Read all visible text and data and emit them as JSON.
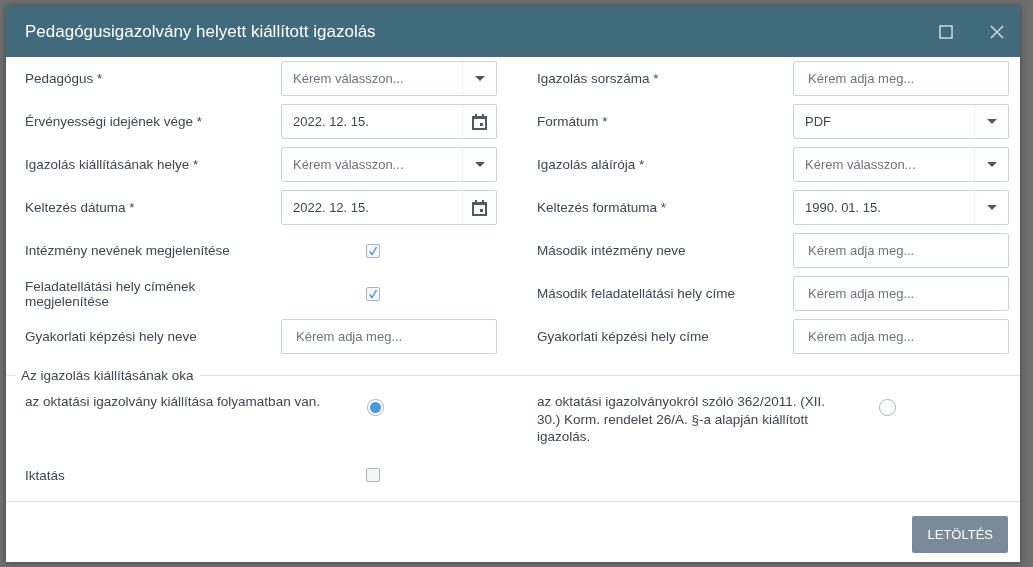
{
  "dialog": {
    "title": "Pedagógusigazolvány helyett kiállított igazolás"
  },
  "rows": [
    {
      "left": {
        "label": "Pedagógus *",
        "kind": "select",
        "placeholder": "Kérem válasszon..."
      },
      "right": {
        "label": "Igazolás sorszáma *",
        "kind": "text",
        "placeholder": "Kérem adja meg..."
      }
    },
    {
      "left": {
        "label": "Érvényességi idejének vége *",
        "kind": "date",
        "value": "2022. 12. 15."
      },
      "right": {
        "label": "Formátum *",
        "kind": "select",
        "value": "PDF"
      }
    },
    {
      "left": {
        "label": "Igazolás kiállításának helye *",
        "kind": "select",
        "placeholder": "Kérem válasszon..."
      },
      "right": {
        "label": "Igazolás aláírója *",
        "kind": "select",
        "placeholder": "Kérem válasszon..."
      }
    },
    {
      "left": {
        "label": "Keltezés dátuma *",
        "kind": "date",
        "value": "2022. 12. 15."
      },
      "right": {
        "label": "Keltezés formátuma *",
        "kind": "select",
        "value": "1990. 01. 15."
      }
    },
    {
      "left": {
        "label": "Intézmény nevének megjelenítése",
        "kind": "checkbox",
        "checked": true
      },
      "right": {
        "label": "Második intézmény neve",
        "kind": "text",
        "placeholder": "Kérem adja meg..."
      }
    },
    {
      "left": {
        "label": "Feladatellátási hely címének megjelenítése",
        "kind": "checkbox",
        "checked": true
      },
      "right": {
        "label": "Második feladatellátási hely címe",
        "kind": "text",
        "placeholder": "Kérem adja meg..."
      }
    },
    {
      "left": {
        "label": "Gyakorlati képzési hely neve",
        "kind": "text",
        "placeholder": "Kérem adja meg..."
      },
      "right": {
        "label": "Gyakorlati képzési hely címe",
        "kind": "text",
        "placeholder": "Kérem adja meg..."
      }
    }
  ],
  "reason": {
    "legend": "Az igazolás kiállításának oka",
    "options": [
      {
        "label": "az oktatási igazolvány kiállítása folyamatban van.",
        "selected": true
      },
      {
        "label": "az oktatási igazolványokról szóló 362/2011. (XII. 30.) Korm. rendelet 26/A. §-a alapján kiállított igazolás.",
        "selected": false
      }
    ],
    "fields": [
      {
        "label": "Iktatás",
        "kind": "checkbox",
        "checked": false
      }
    ]
  },
  "buttons": [
    "LETÖLTÉS"
  ]
}
